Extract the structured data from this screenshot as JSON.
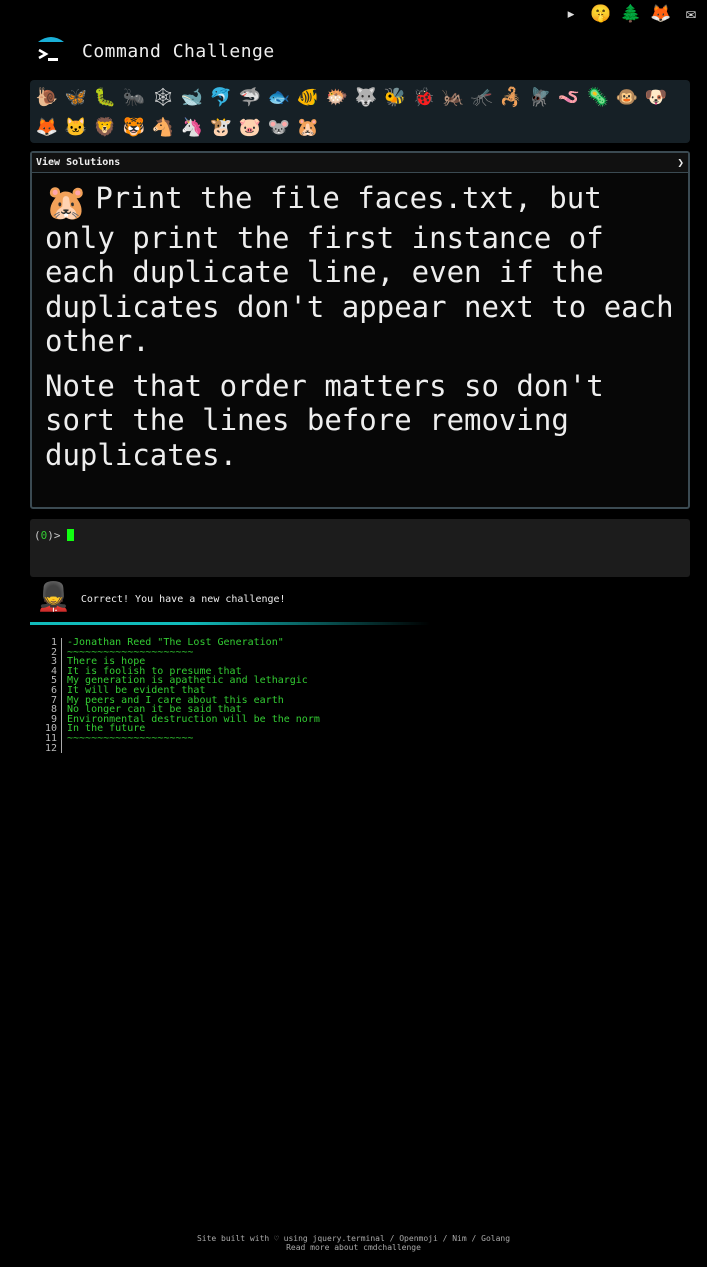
{
  "topbar": {
    "icons": [
      {
        "name": "terminal-logo-icon",
        "glyph": "▸"
      },
      {
        "name": "shush-face-icon",
        "glyph": "🤫"
      },
      {
        "name": "tree-icon",
        "glyph": "🌲"
      },
      {
        "name": "gitlab-icon",
        "glyph": "🦊"
      },
      {
        "name": "mail-icon",
        "glyph": "✉"
      }
    ]
  },
  "header": {
    "title": "Command Challenge"
  },
  "badges": [
    {
      "name": "snail-badge",
      "glyph": "🐌"
    },
    {
      "name": "butterfly-badge",
      "glyph": "🦋"
    },
    {
      "name": "caterpillar-badge",
      "glyph": "🐛"
    },
    {
      "name": "ant-badge",
      "glyph": "🐜"
    },
    {
      "name": "spider-web-badge",
      "glyph": "🕸"
    },
    {
      "name": "whale-badge",
      "glyph": "🐋"
    },
    {
      "name": "dolphin-badge",
      "glyph": "🐬"
    },
    {
      "name": "shark-badge",
      "glyph": "🦈"
    },
    {
      "name": "fish-badge",
      "glyph": "🐟"
    },
    {
      "name": "tropical-fish-badge",
      "glyph": "🐠"
    },
    {
      "name": "blowfish-badge",
      "glyph": "🐡"
    },
    {
      "name": "wolf-badge",
      "glyph": "🐺"
    },
    {
      "name": "bee-badge",
      "glyph": "🐝"
    },
    {
      "name": "ladybug-badge",
      "glyph": "🐞"
    },
    {
      "name": "cricket-badge",
      "glyph": "🦗"
    },
    {
      "name": "mosquito-badge",
      "glyph": "🦟"
    },
    {
      "name": "scorpion-badge",
      "glyph": "🦂"
    },
    {
      "name": "fly-badge",
      "glyph": "🪰"
    },
    {
      "name": "worm-badge",
      "glyph": "🪱"
    },
    {
      "name": "microbe-badge",
      "glyph": "🦠"
    },
    {
      "name": "monkey-badge",
      "glyph": "🐵"
    },
    {
      "name": "dog-badge",
      "glyph": "🐶"
    },
    {
      "name": "fox-badge",
      "glyph": "🦊"
    },
    {
      "name": "cat-badge",
      "glyph": "🐱"
    },
    {
      "name": "lion-badge",
      "glyph": "🦁"
    },
    {
      "name": "tiger-badge",
      "glyph": "🐯"
    },
    {
      "name": "horse-badge",
      "glyph": "🐴"
    },
    {
      "name": "unicorn-badge",
      "glyph": "🦄"
    },
    {
      "name": "cow-badge",
      "glyph": "🐮"
    },
    {
      "name": "pig-badge",
      "glyph": "🐷"
    },
    {
      "name": "mouse-badge",
      "glyph": "🐭"
    },
    {
      "name": "hamster-badge",
      "glyph": "🐹"
    }
  ],
  "challenge": {
    "solutions_label": "View Solutions",
    "chevron": "❯",
    "icon": "🐹",
    "paragraph1": "Print the file faces.txt, but only print the first instance of each duplicate line, even if the duplicates don't appear next to each other.",
    "paragraph2": "Note that order matters so don't sort the lines before removing duplicates."
  },
  "terminal": {
    "prompt_open": "(",
    "prompt_num": "0",
    "prompt_close": ")>"
  },
  "feedback": {
    "icon": "💂",
    "text": "Correct! You have a new challenge!"
  },
  "output": {
    "lines": [
      {
        "n": "1",
        "text": "-Jonathan Reed \"The Lost Generation\""
      },
      {
        "n": "2",
        "text": "~~~~~~~~~~~~~~~~~~~~~"
      },
      {
        "n": "3",
        "text": "There is hope"
      },
      {
        "n": "4",
        "text": "It is foolish to presume that"
      },
      {
        "n": "5",
        "text": "My generation is apathetic and lethargic"
      },
      {
        "n": "6",
        "text": "It will be evident that"
      },
      {
        "n": "7",
        "text": "My peers and I care about this earth"
      },
      {
        "n": "8",
        "text": "No longer can it be said that"
      },
      {
        "n": "9",
        "text": "Environmental destruction will be the norm"
      },
      {
        "n": "10",
        "text": "In the future"
      },
      {
        "n": "11",
        "text": "~~~~~~~~~~~~~~~~~~~~~"
      },
      {
        "n": "12",
        "text": ""
      }
    ]
  },
  "footer": {
    "line1": "Site built with ♡ using jquery.terminal / Openmoji / Nim / Golang",
    "line2": "Read more about cmdchallenge"
  }
}
